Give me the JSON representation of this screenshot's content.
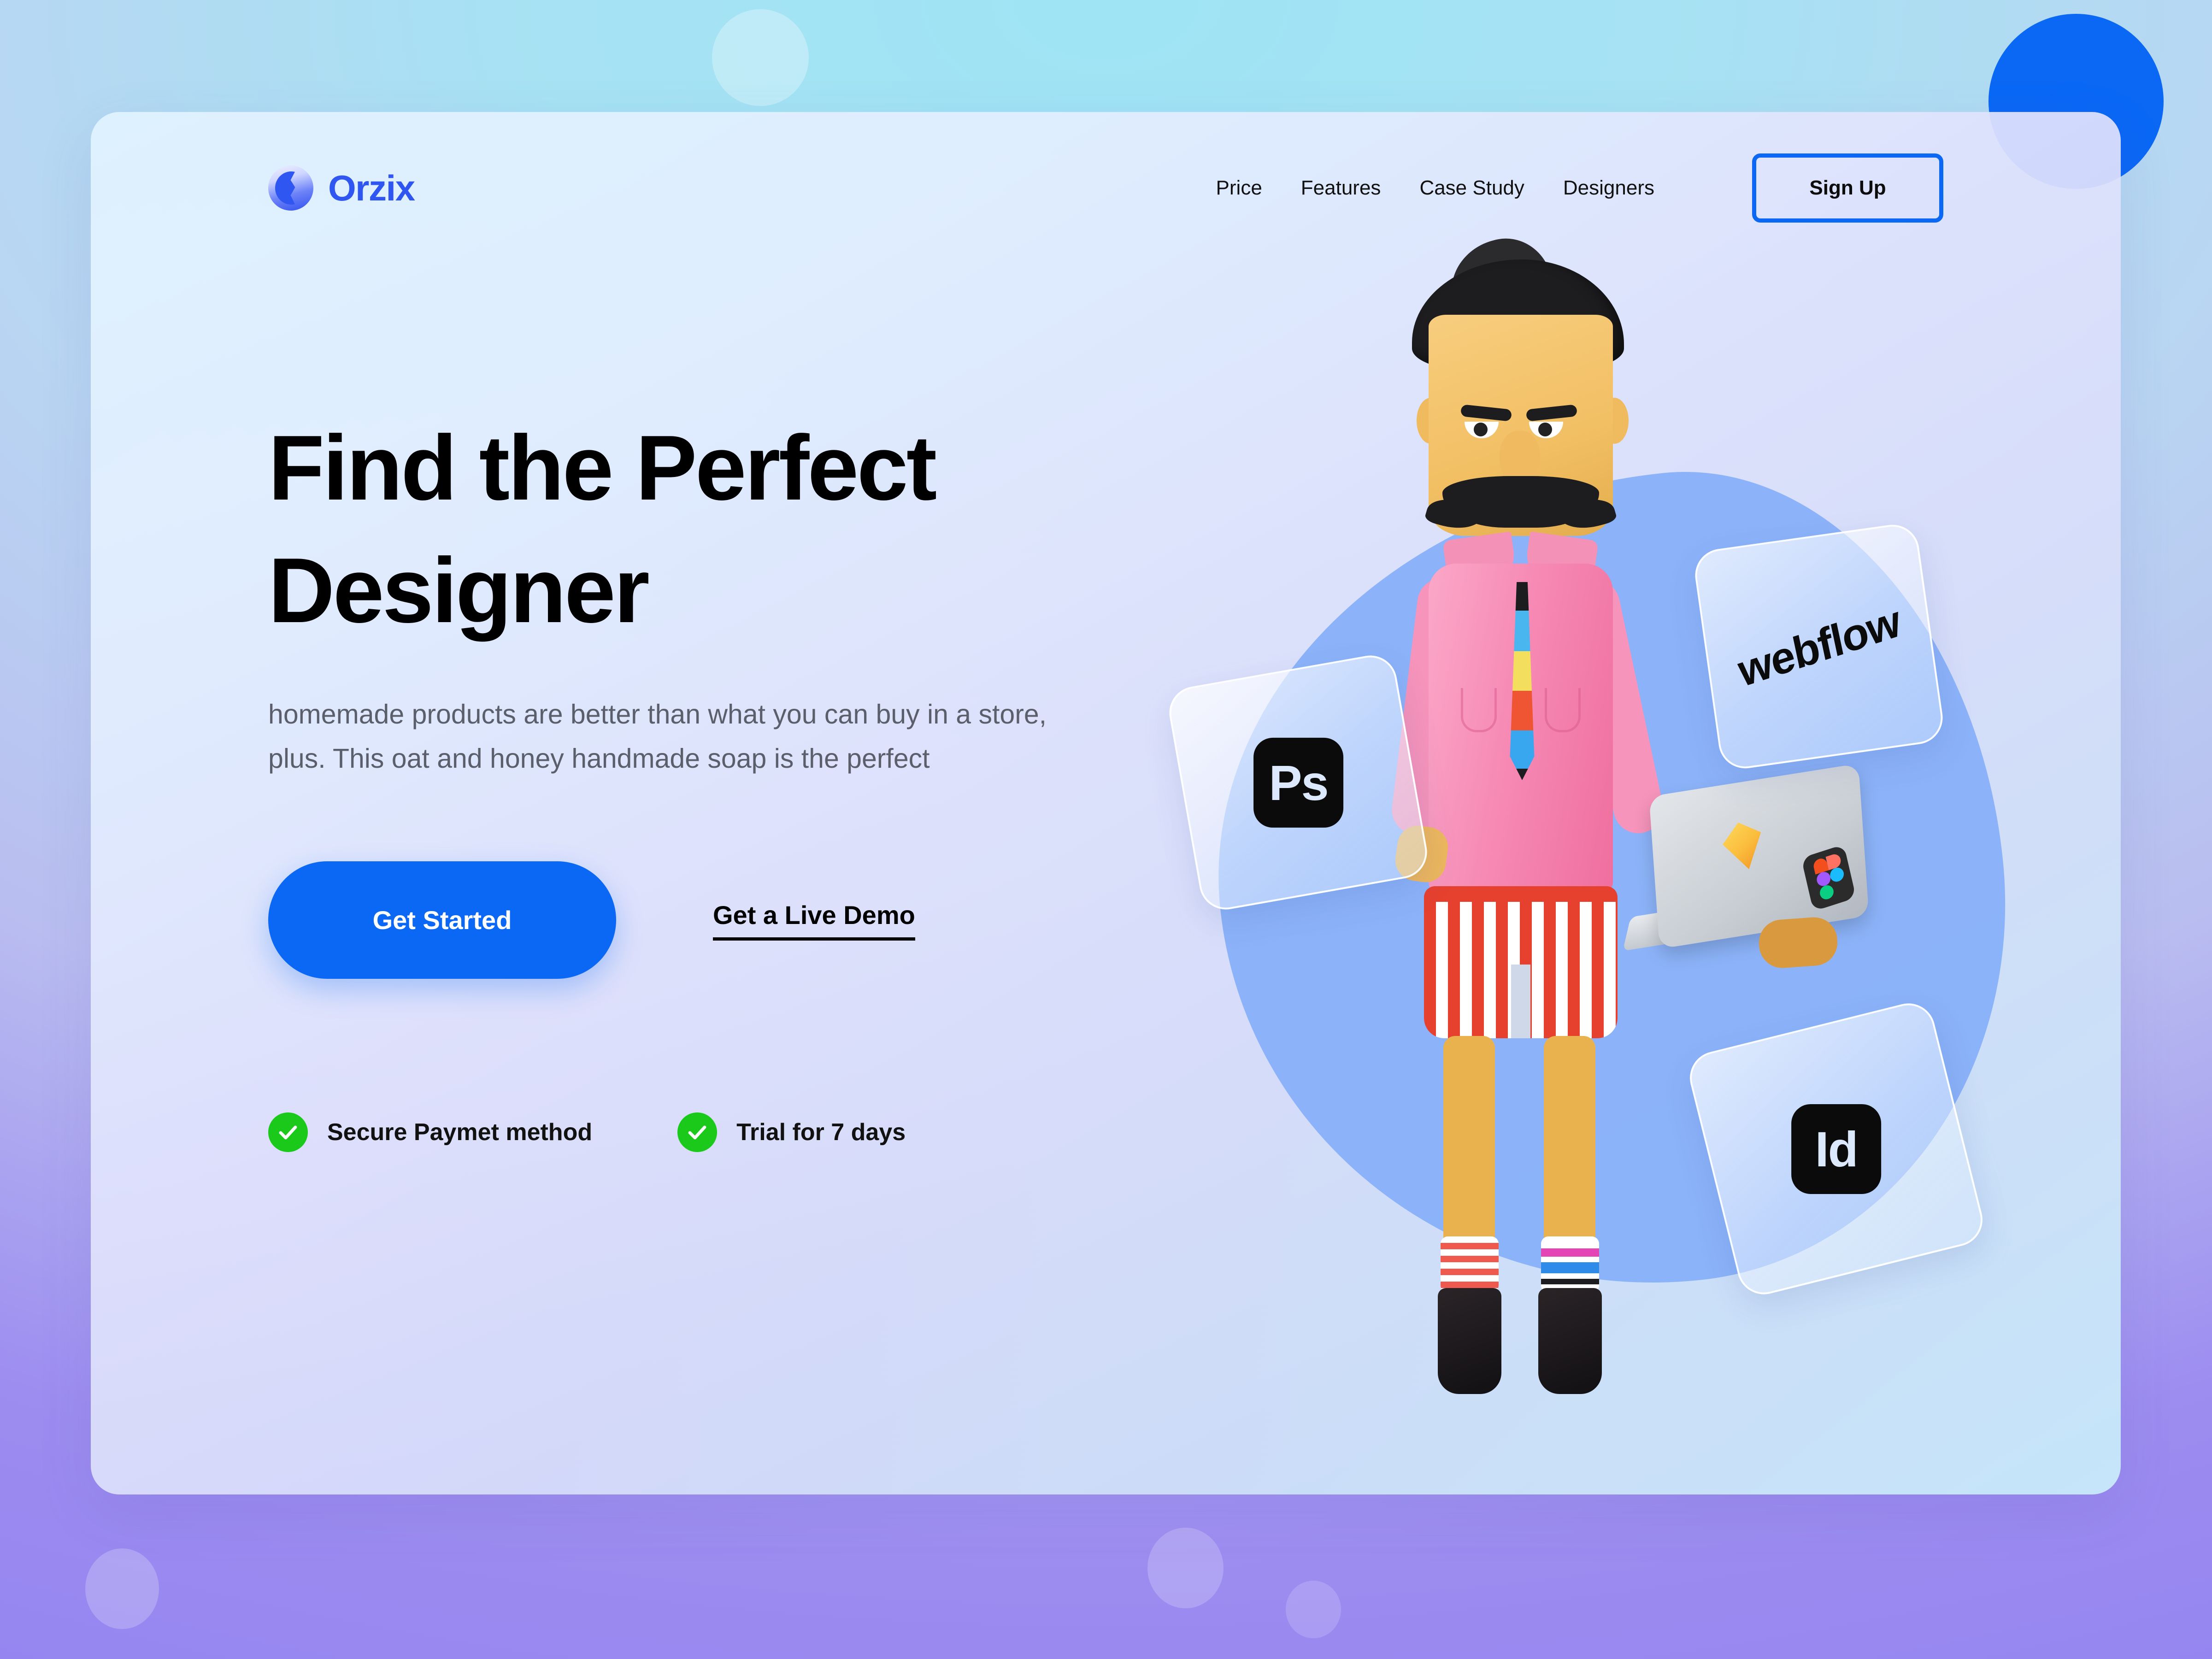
{
  "brand": {
    "name": "Orzix",
    "logo_icon": "orzix-circle-logo",
    "color": "#2f56f0"
  },
  "nav": {
    "links": [
      {
        "label": "Price"
      },
      {
        "label": "Features"
      },
      {
        "label": "Case Study"
      },
      {
        "label": "Designers"
      }
    ],
    "signup": {
      "label": "Sign Up",
      "border_color": "#0a68f5"
    }
  },
  "hero": {
    "headline": "Find the Perfect Designer",
    "subcopy": "homemade products are better than what you can buy in a store, plus. This oat and honey handmade soap is the perfect",
    "primary_cta": {
      "label": "Get Started",
      "bg": "#0a68f5",
      "text": "#ffffff"
    },
    "secondary_cta": {
      "label": "Get a Live Demo"
    },
    "perks": [
      {
        "label": "Secure Paymet method",
        "icon": "check-icon",
        "color": "#1bc91b"
      },
      {
        "label": "Trial for 7 days",
        "icon": "check-icon",
        "color": "#1bc91b"
      }
    ]
  },
  "illustration": {
    "character": "3d-designer-character",
    "app_cards": [
      {
        "id": "photoshop",
        "label": "Ps",
        "icon": "photoshop-icon"
      },
      {
        "id": "webflow",
        "label": "webflow",
        "icon": "webflow-wordmark"
      },
      {
        "id": "indesign",
        "label": "Id",
        "icon": "indesign-icon"
      }
    ],
    "laptop_stickers": [
      {
        "id": "sketch",
        "icon": "sketch-diamond-icon"
      },
      {
        "id": "figma",
        "icon": "figma-icon"
      }
    ]
  },
  "theme": {
    "accent": "#0a68f5",
    "panel_light": "#e0f2fe",
    "bg_top": "#9ee4f5",
    "bg_bottom": "#8f7ff0",
    "success": "#1bc91b"
  }
}
